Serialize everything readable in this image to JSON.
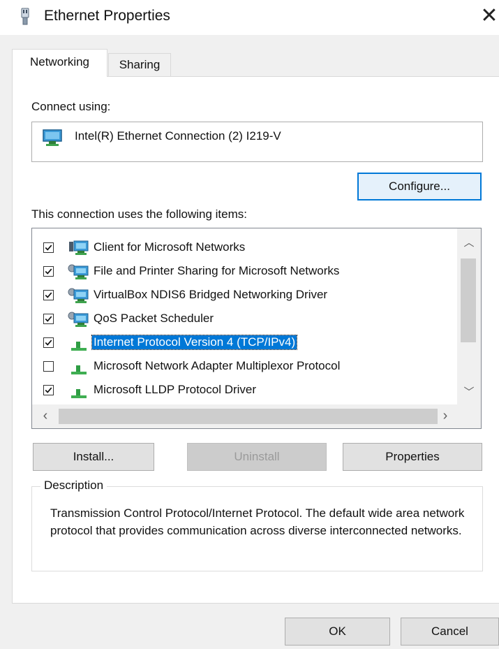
{
  "window": {
    "title": "Ethernet Properties",
    "close_glyph": "✕"
  },
  "tabs": [
    {
      "label": "Networking",
      "selected": true
    },
    {
      "label": "Sharing",
      "selected": false
    }
  ],
  "connect_using": {
    "label": "Connect using:",
    "adapter": "Intel(R) Ethernet Connection (2) I219-V",
    "configure_button": "Configure..."
  },
  "items_section": {
    "label": "This connection uses the following items:",
    "items": [
      {
        "label": "Client for Microsoft Networks",
        "checked": true,
        "icon": "network-client-icon",
        "selected": false
      },
      {
        "label": "File and Printer Sharing for Microsoft Networks",
        "checked": true,
        "icon": "network-service-icon",
        "selected": false
      },
      {
        "label": "VirtualBox NDIS6 Bridged Networking Driver",
        "checked": true,
        "icon": "network-service-icon",
        "selected": false
      },
      {
        "label": "QoS Packet Scheduler",
        "checked": true,
        "icon": "network-service-icon",
        "selected": false
      },
      {
        "label": "Internet Protocol Version 4 (TCP/IPv4)",
        "checked": true,
        "icon": "protocol-icon",
        "selected": true
      },
      {
        "label": "Microsoft Network Adapter Multiplexor Protocol",
        "checked": false,
        "icon": "protocol-icon",
        "selected": false
      },
      {
        "label": "Microsoft LLDP Protocol Driver",
        "checked": true,
        "icon": "protocol-icon",
        "selected": false
      }
    ]
  },
  "buttons": {
    "install": "Install...",
    "uninstall": "Uninstall",
    "properties": "Properties",
    "ok": "OK",
    "cancel": "Cancel"
  },
  "description": {
    "title": "Description",
    "text": "Transmission Control Protocol/Internet Protocol. The default wide area network protocol that provides communication across diverse interconnected networks."
  },
  "colors": {
    "selection": "#0078d7",
    "dialog_bg": "#f0f0f0",
    "button_bg": "#e1e1e1"
  }
}
